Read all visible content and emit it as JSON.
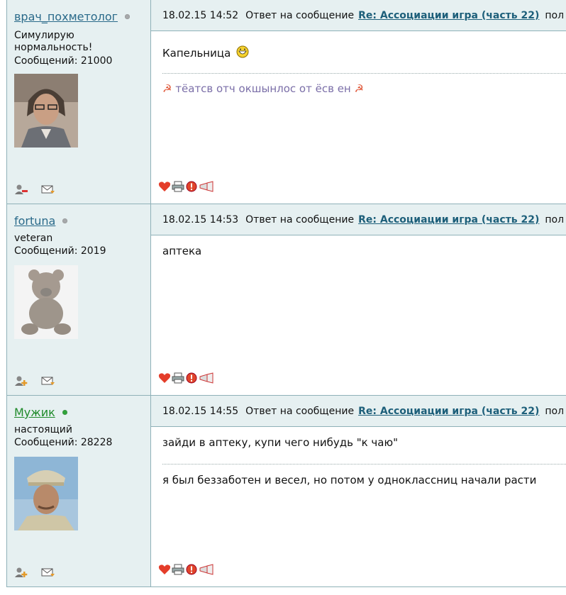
{
  "posts": [
    {
      "username": "врач_похметолог",
      "online": false,
      "rank": "Симулирую нормальность!",
      "count_label": "Сообщений: 21000",
      "datetime": "18.02.15 14:52",
      "reply_prefix": "Ответ на сообщение",
      "reply_link": "Re: Ассоциации игра (часть 22)",
      "reply_tail": "пол",
      "message": "Капельница",
      "signature": "тёатсв отч окшынлос от ёсв ен",
      "avatar": "man-in-glasses-photo"
    },
    {
      "username": "fortuna",
      "online": false,
      "rank": "veteran",
      "count_label": "Сообщений: 2019",
      "datetime": "18.02.15 14:53",
      "reply_prefix": "Ответ на сообщение",
      "reply_link": "Re: Ассоциации игра (часть 22)",
      "reply_tail": "пол",
      "message": "аптека",
      "avatar": "teddy-bear-photo"
    },
    {
      "username": "Мужик",
      "online": true,
      "rank": "настоящий",
      "count_label": "Сообщений: 28228",
      "datetime": "18.02.15 14:55",
      "reply_prefix": "Ответ на сообщение",
      "reply_link": "Re: Ассоциации игра (часть 22)",
      "reply_tail": "пол",
      "message": "зайди в аптеку, купи чего нибудь \"к чаю\"",
      "signature": "я был беззаботен и весел, но потом у одноклассниц начали расти",
      "avatar": "soldier-in-cap-photo"
    }
  ],
  "colors": {
    "header_bg": "#e6f0f1",
    "border": "#8fb1b8",
    "link": "#2a6a8a",
    "online": "#2fa43a",
    "signature": "#7b6fa8"
  }
}
